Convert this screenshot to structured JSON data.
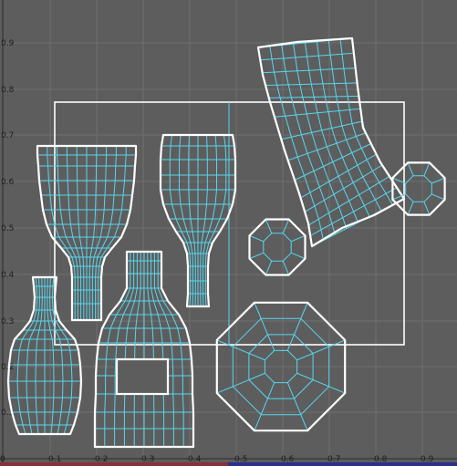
{
  "editor": {
    "name": "uv-editor-viewport"
  },
  "axes": {
    "y_ticks": [
      "0.9",
      "0.8",
      "0.7",
      "0.6",
      "0.5",
      "0.4",
      "0.3",
      "0.2",
      "0.1"
    ],
    "x_ticks": [
      "0",
      "0.1",
      "0.2",
      "0.3",
      "0.4",
      "0.5",
      "0.6",
      "0.7",
      "0.8",
      "0.9"
    ]
  },
  "colors": {
    "background": "#5d5d5d",
    "grid": "#6e6e6e",
    "wireframe": "#58d6ee",
    "border": "#ffffff",
    "bottom_strip_left": "#8a2f3c",
    "bottom_strip_right": "#2d2f8a"
  }
}
